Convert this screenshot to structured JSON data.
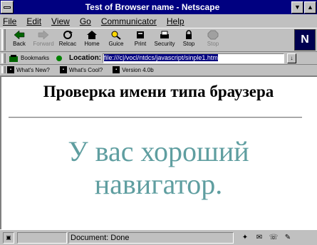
{
  "window": {
    "title": "Test of Browser name - Netscape"
  },
  "menu": [
    "File",
    "Edit",
    "View",
    "Go",
    "Communicator",
    "Help"
  ],
  "toolbar": {
    "items": [
      {
        "label": "Back",
        "icon": "back-arrow-icon",
        "enabled": true
      },
      {
        "label": "Forward",
        "icon": "forward-arrow-icon",
        "enabled": false
      },
      {
        "label": "Reload",
        "icon": "reload-icon",
        "enabled": true
      },
      {
        "label": "Home",
        "icon": "home-icon",
        "enabled": true
      },
      {
        "label": "Search",
        "icon": "search-icon",
        "enabled": true
      },
      {
        "label": "Guide",
        "icon": "guide-icon",
        "enabled": true
      },
      {
        "label": "Print",
        "icon": "print-icon",
        "enabled": true
      },
      {
        "label": "Security",
        "icon": "security-lock-icon",
        "enabled": true
      },
      {
        "label": "Stop",
        "icon": "stop-icon",
        "enabled": false
      }
    ],
    "visible_labels": [
      "Back",
      "Forward",
      "Relcac",
      "Home",
      "Guice",
      "Print",
      "Security",
      "Stop"
    ]
  },
  "location": {
    "bookmarks_label": "Bookmarks",
    "label": "Location:",
    "url": "file:///c|/vocl/ntdcs/javascript/sinple1.htm"
  },
  "personal": [
    "What's New?",
    "What's Cool?",
    "Version 4.0b"
  ],
  "content": {
    "heading": "Проверка имени типа браузера",
    "message": "У вас хороший навигатор."
  },
  "status": {
    "text": "Document: Done"
  },
  "colors": {
    "titlebar": "#000080",
    "message": "#5f9ea0"
  }
}
